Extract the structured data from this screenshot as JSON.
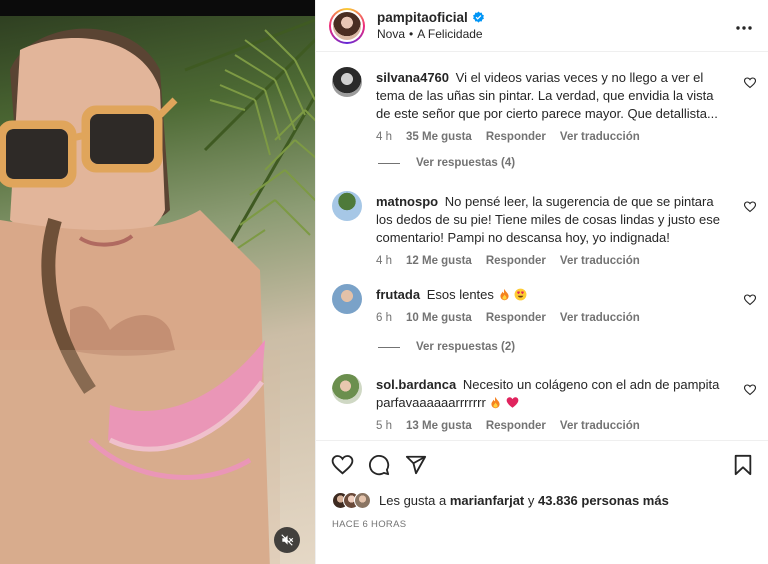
{
  "post": {
    "username": "pampitaoficial",
    "verified": true,
    "audio": "Nova",
    "location": "A Felicidade",
    "separator": "•"
  },
  "comments": [
    {
      "user": "silvana4760",
      "text": "Vi el videos varias veces y no llego a ver el tema de las uñas sin pintar. La verdad, que envidia la vista de este señor que por cierto parece mayor. Que detallista...",
      "time": "4 h",
      "likes": "35 Me gusta",
      "reply": "Responder",
      "translate": "Ver traducción",
      "view_replies": "Ver respuestas (4)"
    },
    {
      "user": "matnospo",
      "text": "No pensé leer, la sugerencia de que se pintara los dedos de su pie! Tiene miles de cosas lindas y justo ese comentario! Pampi no descansa hoy, yo indignada!",
      "time": "4 h",
      "likes": "12 Me gusta",
      "reply": "Responder",
      "translate": "Ver traducción"
    },
    {
      "user": "frutada",
      "text": "Esos lentes",
      "emojis": [
        "fire-emoji",
        "heart-eyes-emoji"
      ],
      "time": "6 h",
      "likes": "10 Me gusta",
      "reply": "Responder",
      "translate": "Ver traducción",
      "view_replies": "Ver respuestas (2)"
    },
    {
      "user": "sol.bardanca",
      "text": "Necesito un colágeno con el adn de pampita parfavaaaaaarrrrrrr",
      "emojis": [
        "fire-emoji",
        "red-heart-emoji"
      ],
      "time": "5 h",
      "likes": "13 Me gusta",
      "reply": "Responder",
      "translate": "Ver traducción"
    }
  ],
  "likes": {
    "prefix": "Les gusta a",
    "user": "marianfarjat",
    "joiner": "y",
    "count": "43.836 personas más"
  },
  "posted_ago": "HACE 6 HORAS",
  "icons": {
    "header_more": "more-options-icon",
    "like": "heart-icon",
    "comment": "comment-icon",
    "share": "share-icon",
    "save": "bookmark-icon",
    "mute": "muted-speaker-icon"
  },
  "colors": {
    "text": "#262626",
    "secondary": "#737373",
    "verified": "#0095f6",
    "border": "#efefef"
  }
}
